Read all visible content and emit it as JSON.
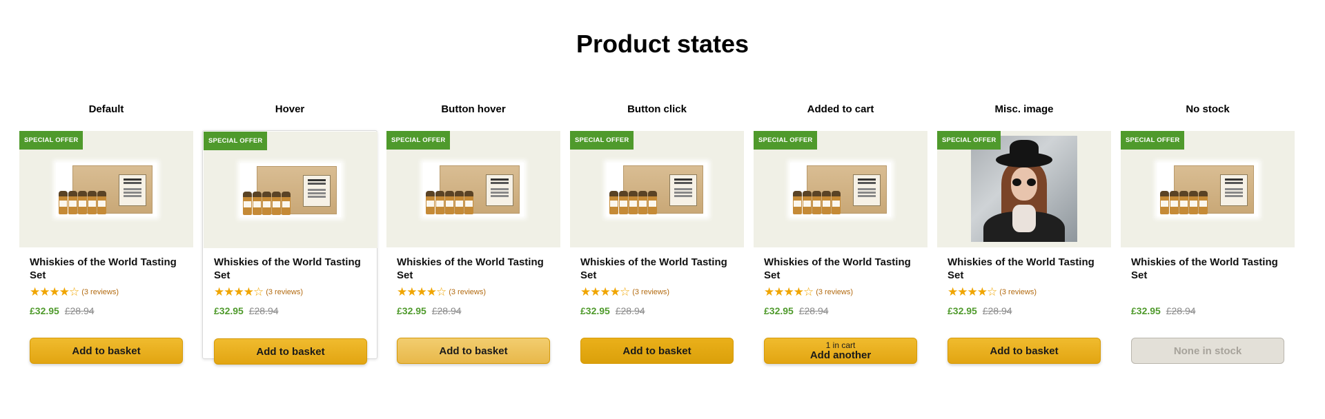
{
  "page": {
    "title": "Product states"
  },
  "product": {
    "badge": "SPECIAL OFFER",
    "title": "Whiskies of the World Tasting Set",
    "rating": 4,
    "rating_max": 5,
    "stars_display": "★★★★☆",
    "reviews": "(3 reviews)",
    "price": "£32.95",
    "was_price": "£28.94"
  },
  "states": [
    {
      "label": "Default",
      "button": "Add to basket"
    },
    {
      "label": "Hover",
      "button": "Add to basket"
    },
    {
      "label": "Button hover",
      "button": "Add to basket"
    },
    {
      "label": "Button click",
      "button": "Add to basket"
    },
    {
      "label": "Added to cart",
      "button_small": "1 in cart",
      "button": "Add another"
    },
    {
      "label": "Misc. image",
      "button": "Add to basket"
    },
    {
      "label": "No stock",
      "button": "None in stock"
    }
  ],
  "colors": {
    "badge": "#4f9a2c",
    "price": "#4f9a2c",
    "stars": "#f0a500",
    "button": "#f0bb2e",
    "image_bg": "#f0f0e6"
  }
}
